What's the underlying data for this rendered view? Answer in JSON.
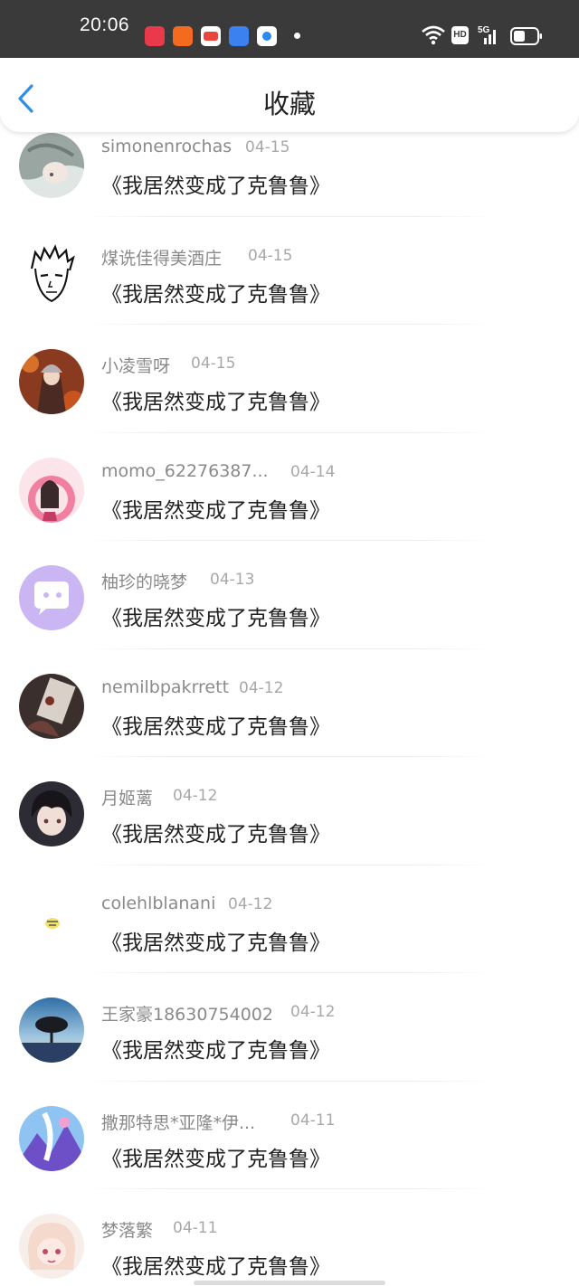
{
  "status_bar": {
    "time": "20:06",
    "hd_label": "HD",
    "net_label": "5G"
  },
  "header": {
    "title": "收藏"
  },
  "favorites": [
    {
      "user": "simonenrochas",
      "date": "04-15",
      "work": "《我居然变成了克鲁鲁》",
      "avatar": "avatar-gray-hair"
    },
    {
      "user": "煤诜佳得美酒庄",
      "date": "04-15",
      "work": "《我居然变成了克鲁鲁》",
      "avatar": "avatar-sketch-face"
    },
    {
      "user": "小凌雪呀",
      "date": "04-15",
      "work": "《我居然变成了克鲁鲁》",
      "avatar": "avatar-autumn-girl"
    },
    {
      "user": "momo_62276387...",
      "date": "04-14",
      "work": "《我居然变成了克鲁鲁》",
      "avatar": "avatar-pink-circle"
    },
    {
      "user": "柚珍的晓梦",
      "date": "04-13",
      "work": "《我居然变成了克鲁鲁》",
      "avatar": "avatar-default-chat"
    },
    {
      "user": "nemilbpakrrett",
      "date": "04-12",
      "work": "《我居然变成了克鲁鲁》",
      "avatar": "avatar-dark-card"
    },
    {
      "user": "月姬蓠",
      "date": "04-12",
      "work": "《我居然变成了克鲁鲁》",
      "avatar": "avatar-dark-hair-boy"
    },
    {
      "user": "colehlblanani",
      "date": "04-12",
      "work": "《我居然变成了克鲁鲁》",
      "avatar": "avatar-small-sticker"
    },
    {
      "user": "王家豪18630754002",
      "date": "04-12",
      "work": "《我居然变成了克鲁鲁》",
      "avatar": "avatar-tree-sunset"
    },
    {
      "user": "撒那特思*亚隆*伊...",
      "date": "04-11",
      "work": "《我居然变成了克鲁鲁》",
      "avatar": "avatar-blue-fantasy"
    },
    {
      "user": "梦落繁",
      "date": "04-11",
      "work": "《我居然变成了克鲁鲁》",
      "avatar": "avatar-chibi-girl"
    }
  ]
}
